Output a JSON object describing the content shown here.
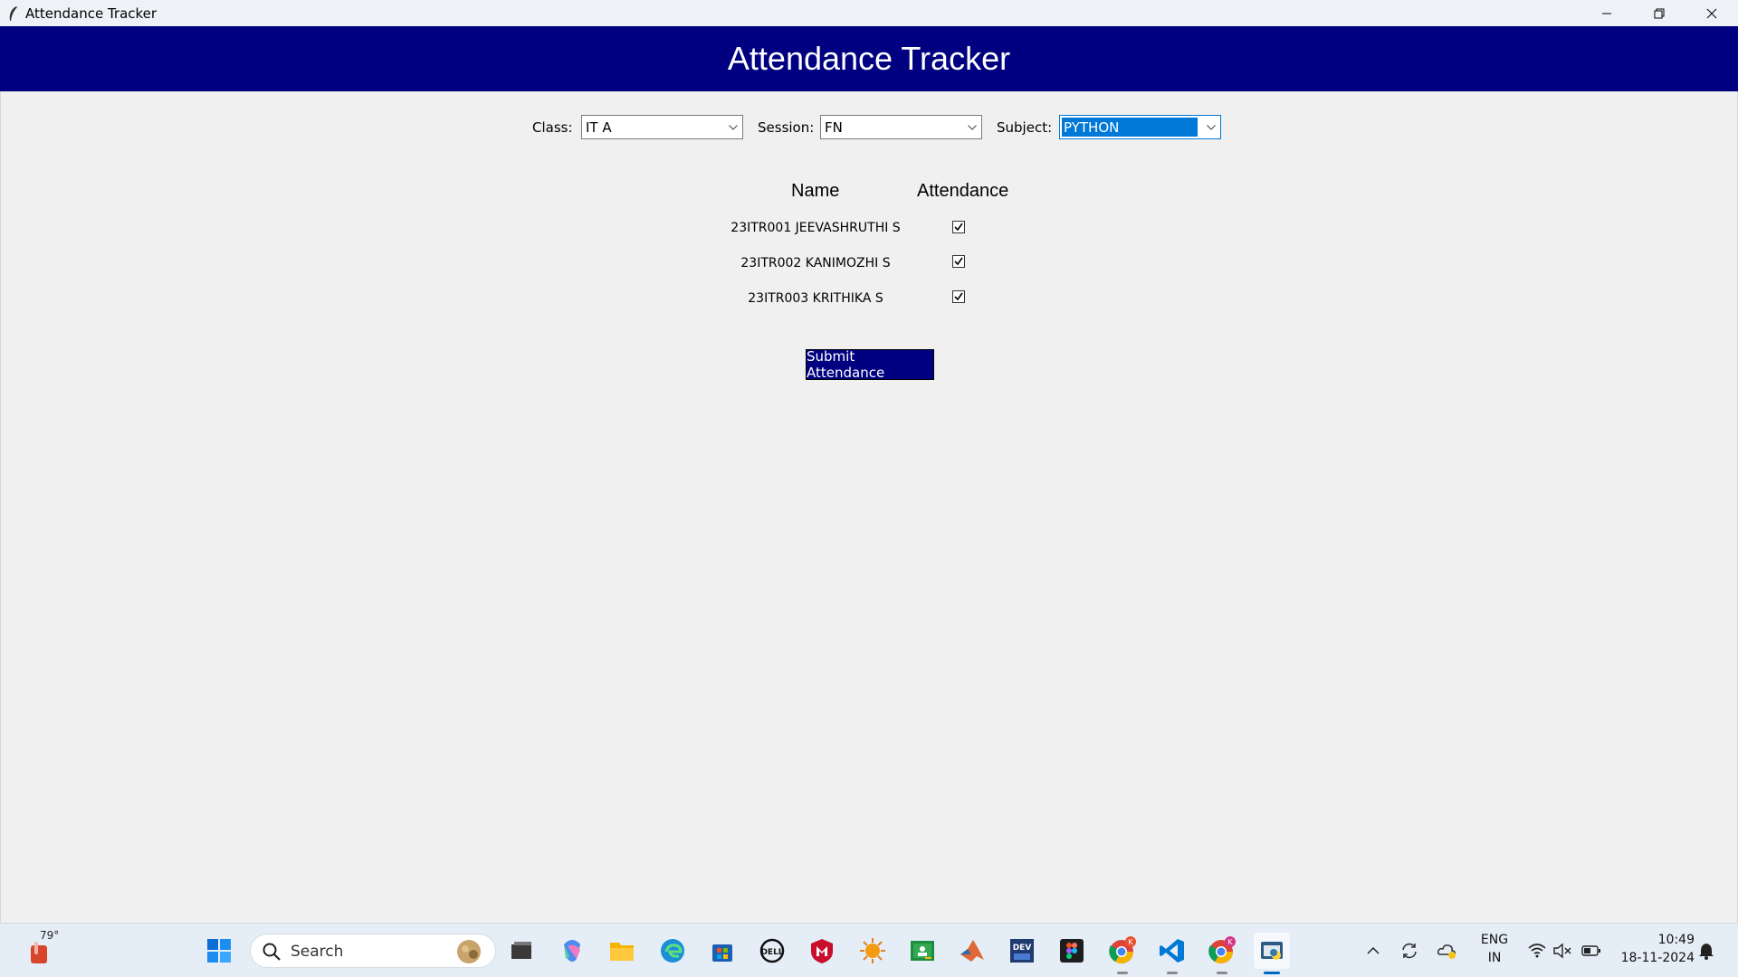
{
  "window": {
    "title": "Attendance Tracker"
  },
  "header": {
    "title": "Attendance Tracker"
  },
  "filters": {
    "class_label": "Class:",
    "class_value": "IT A",
    "session_label": "Session:",
    "session_value": "FN",
    "subject_label": "Subject:",
    "subject_value": "PYTHON"
  },
  "table": {
    "columns": [
      "Name",
      "Attendance"
    ],
    "rows": [
      {
        "name": "23ITR001 JEEVASHRUTHI S",
        "present": true
      },
      {
        "name": "23ITR002 KANIMOZHI S",
        "present": true
      },
      {
        "name": "23ITR003 KRITHIKA S",
        "present": true
      }
    ]
  },
  "submit_label": "Submit Attendance",
  "taskbar": {
    "weather_temp": "79°",
    "search_label": "Search",
    "lang_top": "ENG",
    "lang_bottom": "IN",
    "time": "10:49",
    "date": "18-11-2024",
    "chrome_badge": "K",
    "icons": [
      "windows-start-icon",
      "file-explorer-icon",
      "copilot-icon",
      "folder-icon",
      "edge-icon",
      "store-icon",
      "dell-icon",
      "mcafee-icon",
      "sun-app-icon",
      "classroom-icon",
      "matlab-icon",
      "dev-icon",
      "figma-icon",
      "chrome-icon",
      "vscode-icon",
      "chrome-profile-icon",
      "python-app-icon"
    ]
  },
  "colors": {
    "header_bg": "#000080",
    "button_bg": "#000080",
    "focus_blue": "#0078d7"
  }
}
